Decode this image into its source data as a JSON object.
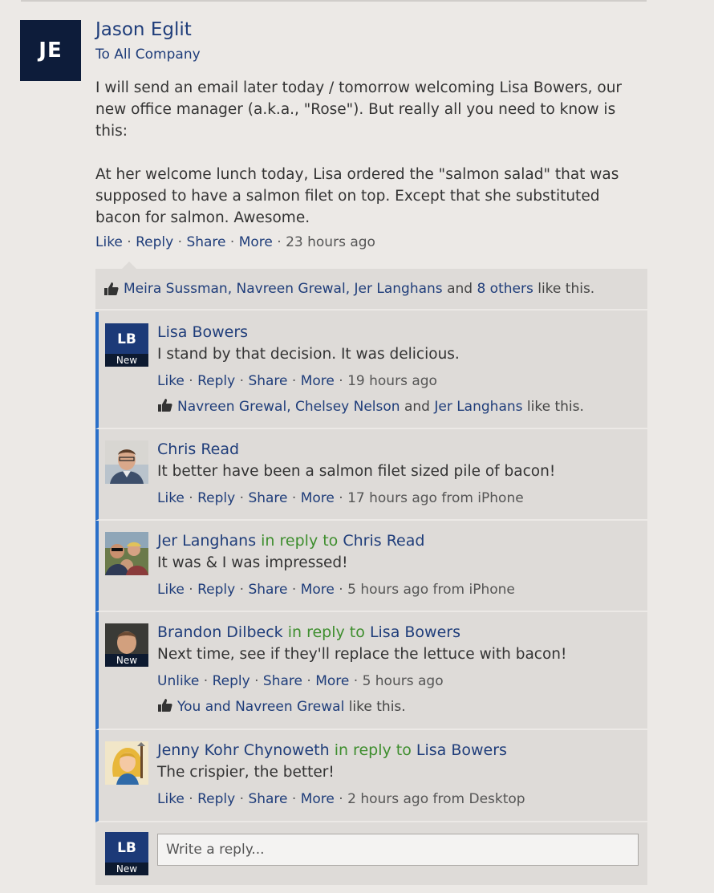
{
  "post": {
    "avatar_initials": "JE",
    "author": "Jason Eglit",
    "audience": "To All Company",
    "paragraphs": [
      "I will send an email later today / tomorrow welcoming Lisa Bowers, our new office manager (a.k.a., \"Rose\"). But really all you need to know is this:",
      "At her welcome lunch today, Lisa ordered the \"salmon salad\" that was supposed to have a salmon filet on top. Except that she substituted bacon for salmon. Awesome."
    ],
    "actions": {
      "like": "Like",
      "reply": "Reply",
      "share": "Share",
      "more": "More",
      "time": "23 hours ago"
    },
    "likes": {
      "names": "Meira Sussman, Navreen Grewal, Jer Langhans",
      "and": "and",
      "others": "8 others",
      "suffix": "like this."
    }
  },
  "new_badge": "New",
  "replies": [
    {
      "avatar_initials": "LB",
      "author": "Lisa Bowers",
      "text": "I stand by that decision. It was delicious.",
      "actions": {
        "like": "Like",
        "reply": "Reply",
        "share": "Share",
        "more": "More",
        "time": "19 hours ago"
      },
      "likes": {
        "names": "Navreen Grewal, Chelsey Nelson",
        "and": "and",
        "last": "Jer Langhans",
        "suffix": "like this."
      }
    },
    {
      "author": "Chris Read",
      "text": "It better have been a salmon filet sized pile of bacon!",
      "actions": {
        "like": "Like",
        "reply": "Reply",
        "share": "Share",
        "more": "More",
        "time": "17 hours ago from iPhone"
      }
    },
    {
      "author": "Jer Langhans",
      "in_reply": "in reply to",
      "reply_to": "Chris Read",
      "text": "It was & I was impressed!",
      "actions": {
        "like": "Like",
        "reply": "Reply",
        "share": "Share",
        "more": "More",
        "time": "5 hours ago from iPhone"
      }
    },
    {
      "author": "Brandon Dilbeck",
      "in_reply": "in reply to",
      "reply_to": "Lisa Bowers",
      "text": "Next time, see if they'll replace the lettuce with bacon!",
      "actions": {
        "like": "Unlike",
        "reply": "Reply",
        "share": "Share",
        "more": "More",
        "time": "5 hours ago"
      },
      "likes": {
        "names": "You and Navreen Grewal",
        "suffix": "like this."
      }
    },
    {
      "author": "Jenny Kohr Chynoweth",
      "in_reply": "in reply to",
      "reply_to": "Lisa Bowers",
      "text": "The crispier, the better!",
      "actions": {
        "like": "Like",
        "reply": "Reply",
        "share": "Share",
        "more": "More",
        "time": "2 hours ago from Desktop"
      }
    }
  ],
  "composer": {
    "avatar_initials": "LB",
    "placeholder": "Write a reply..."
  },
  "colors": {
    "link": "#1f3d7a",
    "in_reply": "#3e8e2e",
    "thread_bar": "#2a6fc9",
    "avatar_bg": "#0d1c3a"
  }
}
